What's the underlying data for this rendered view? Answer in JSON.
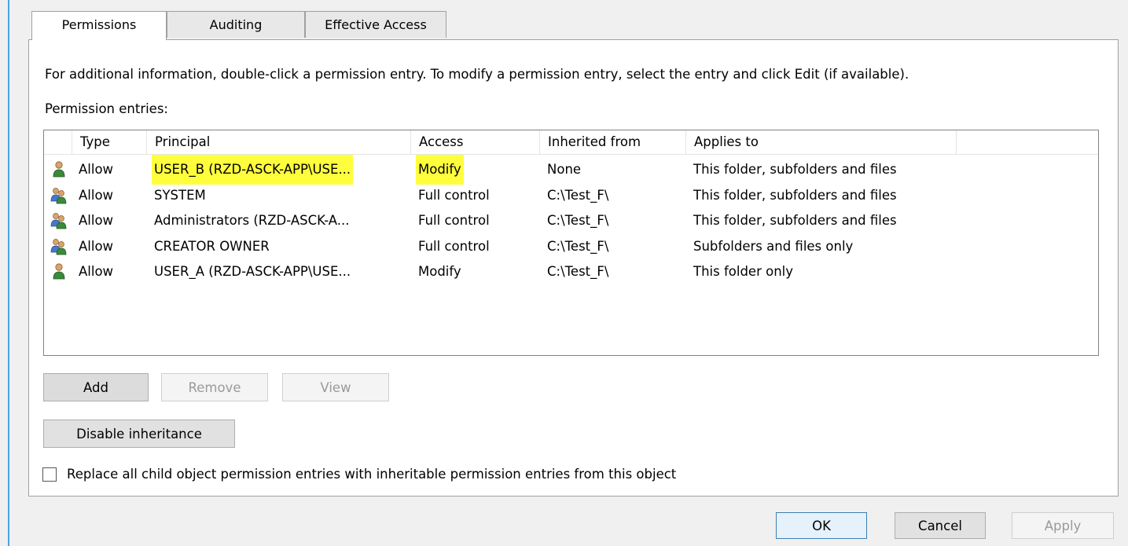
{
  "tabs": [
    {
      "label": "Permissions",
      "active": true
    },
    {
      "label": "Auditing",
      "active": false
    },
    {
      "label": "Effective Access",
      "active": false
    }
  ],
  "info_text": "For additional information, double-click a permission entry. To modify a permission entry, select the entry and click Edit (if available).",
  "entries_label": "Permission entries:",
  "columns": {
    "type": "Type",
    "principal": "Principal",
    "access": "Access",
    "inherited_from": "Inherited from",
    "applies_to": "Applies to"
  },
  "entries": [
    {
      "icon": "user-icon",
      "type": "Allow",
      "principal": "USER_B (RZD-ASCK-APP\\USE...",
      "access": "Modify",
      "inherited_from": "None",
      "applies_to": "This folder, subfolders and files"
    },
    {
      "icon": "group-icon",
      "type": "Allow",
      "principal": "SYSTEM",
      "access": "Full control",
      "inherited_from": "C:\\Test_F\\",
      "applies_to": "This folder, subfolders and files"
    },
    {
      "icon": "group-icon",
      "type": "Allow",
      "principal": "Administrators (RZD-ASCK-A...",
      "access": "Full control",
      "inherited_from": "C:\\Test_F\\",
      "applies_to": "This folder, subfolders and files"
    },
    {
      "icon": "group-icon",
      "type": "Allow",
      "principal": "CREATOR OWNER",
      "access": "Full control",
      "inherited_from": "C:\\Test_F\\",
      "applies_to": "Subfolders and files only"
    },
    {
      "icon": "user-icon",
      "type": "Allow",
      "principal": "USER_A (RZD-ASCK-APP\\USE...",
      "access": "Modify",
      "inherited_from": "C:\\Test_F\\",
      "applies_to": "This folder only"
    }
  ],
  "highlight_color": "#fffe3d",
  "buttons": {
    "add": "Add",
    "remove": "Remove",
    "view": "View",
    "disable_inheritance": "Disable inheritance",
    "ok": "OK",
    "cancel": "Cancel",
    "apply": "Apply"
  },
  "replace_checkbox": {
    "label": "Replace all child object permission entries with inheritable permission entries from this object",
    "checked": false
  }
}
